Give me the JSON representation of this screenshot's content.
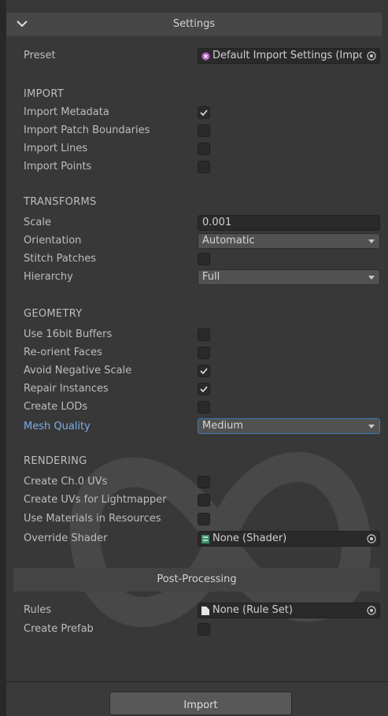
{
  "header": {
    "title": "Settings"
  },
  "preset": {
    "label": "Preset",
    "value": "Default Import Settings (Impo"
  },
  "import": {
    "title": "IMPORT",
    "rows": [
      {
        "label": "Import Metadata",
        "checked": true
      },
      {
        "label": "Import Patch Boundaries",
        "checked": false
      },
      {
        "label": "Import Lines",
        "checked": false
      },
      {
        "label": "Import Points",
        "checked": false
      }
    ]
  },
  "transforms": {
    "title": "TRANSFORMS",
    "scale_label": "Scale",
    "scale_value": "0.001",
    "orientation_label": "Orientation",
    "orientation_value": "Automatic",
    "stitch_label": "Stitch Patches",
    "stitch_checked": false,
    "hierarchy_label": "Hierarchy",
    "hierarchy_value": "Full"
  },
  "geometry": {
    "title": "GEOMETRY",
    "rows": [
      {
        "label": "Use 16bit Buffers",
        "checked": false
      },
      {
        "label": "Re-orient Faces",
        "checked": false
      },
      {
        "label": "Avoid Negative Scale",
        "checked": true
      },
      {
        "label": "Repair Instances",
        "checked": true
      },
      {
        "label": "Create LODs",
        "checked": false
      }
    ],
    "mesh_quality_label": "Mesh Quality",
    "mesh_quality_value": "Medium"
  },
  "rendering": {
    "title": "RENDERING",
    "rows": [
      {
        "label": "Create Ch.0 UVs",
        "checked": false
      },
      {
        "label": "Create UVs for Lightmapper",
        "checked": false
      },
      {
        "label": "Use Materials in Resources",
        "checked": false
      }
    ],
    "override_shader_label": "Override Shader",
    "override_shader_value": "None (Shader)"
  },
  "post_processing": {
    "title": "Post-Processing",
    "rules_label": "Rules",
    "rules_value": "None (Rule Set)",
    "create_prefab_label": "Create Prefab",
    "create_prefab_checked": false
  },
  "footer": {
    "import_label": "Import"
  },
  "colors": {
    "accent": "#3a79bb",
    "highlight_label": "#7bafe8",
    "panel": "#383838"
  }
}
